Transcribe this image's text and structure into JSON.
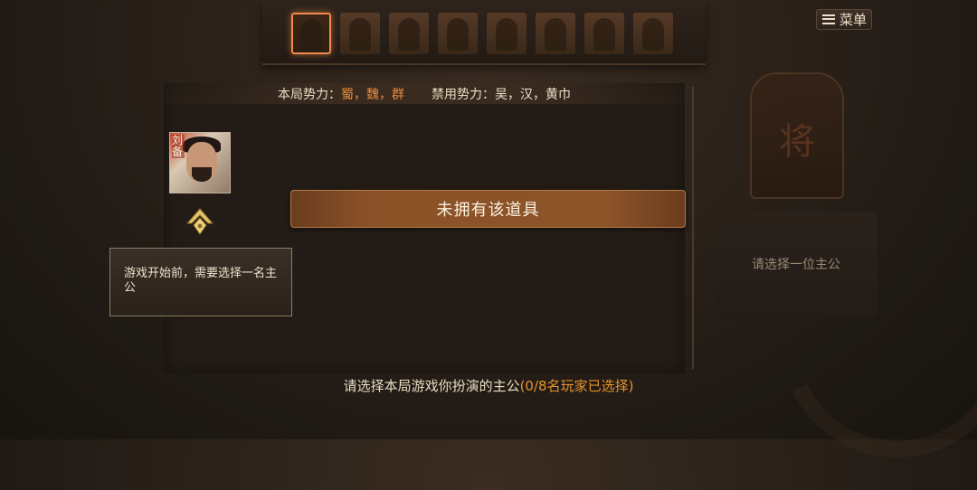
{
  "menu": {
    "label": "菜单",
    "icon": "hamburger-menu-icon"
  },
  "seats": {
    "total": 8,
    "active_index": 0
  },
  "factions": {
    "active_label": "本局势力：",
    "active_value": "蜀，魏，群",
    "banned_label": "禁用势力：",
    "banned_value": "吴，汉，黄巾",
    "active_color": "#e88b3d"
  },
  "lord": {
    "name": "刘备",
    "rank_icon": "rank-emblem-icon"
  },
  "tooltip": {
    "text": "游戏开始前，需要选择一名主公"
  },
  "notice": {
    "text": "未拥有该道具"
  },
  "right_panel": {
    "card_glyph": "将",
    "placeholder": "请选择一位主公"
  },
  "prompt": {
    "text": "请选择本局游戏你扮演的主公",
    "count": "(0/8名玩家已选择)",
    "count_color": "#e8922f"
  }
}
